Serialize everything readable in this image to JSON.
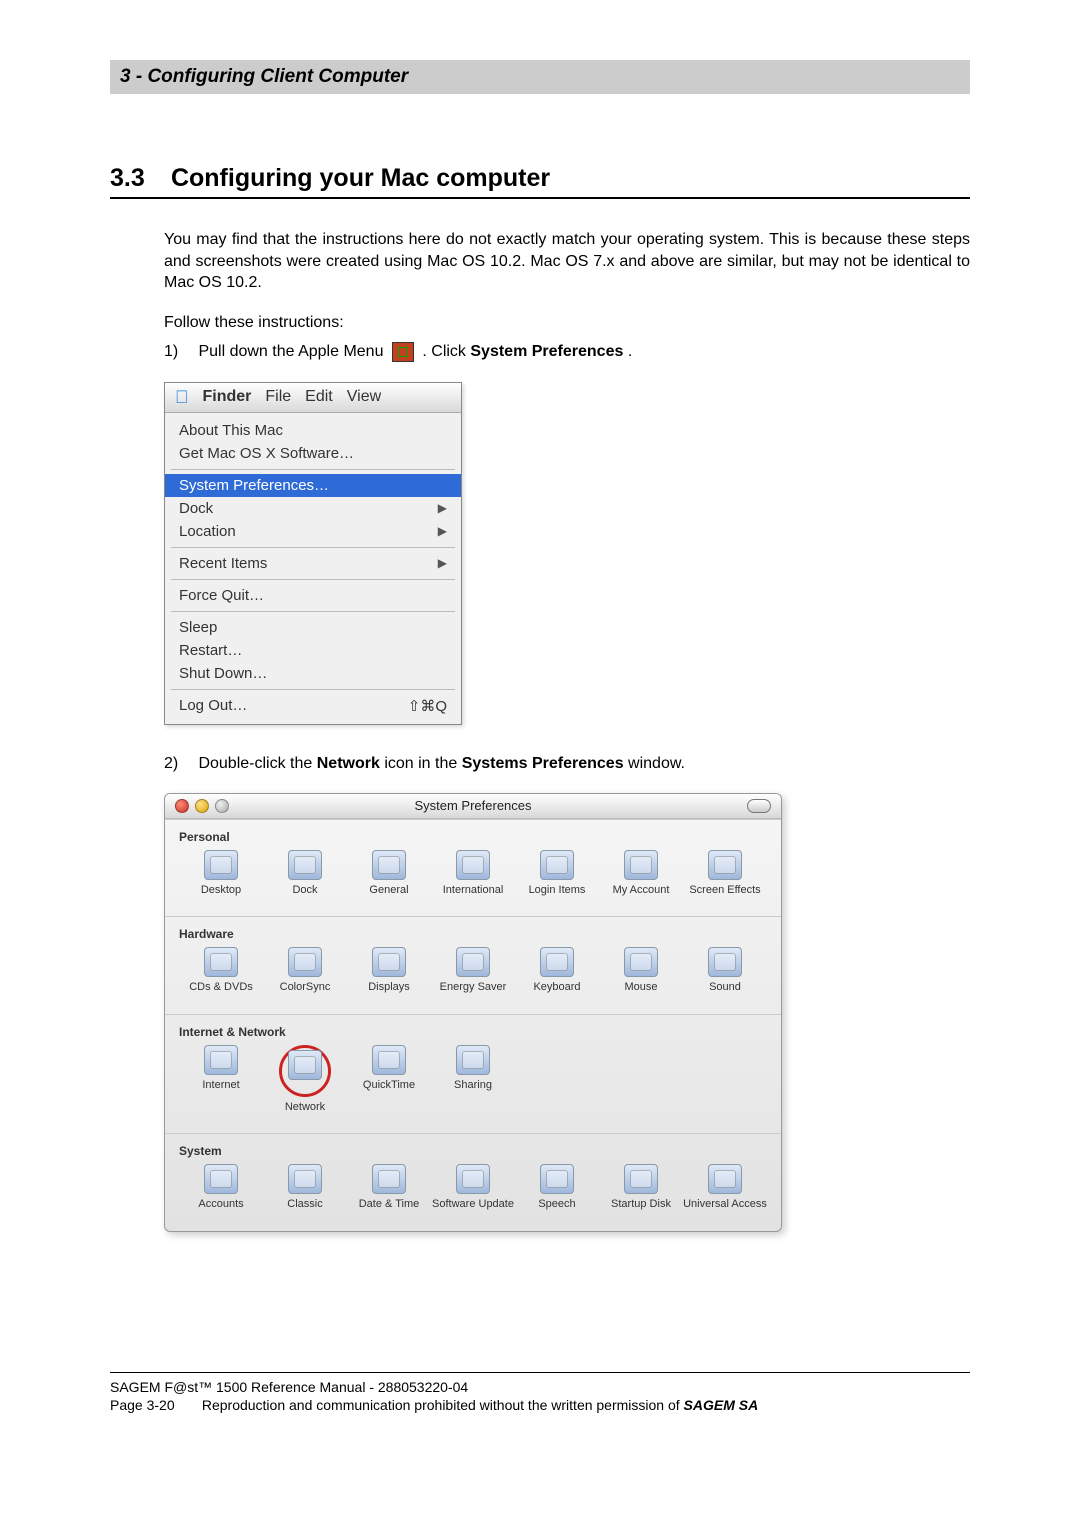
{
  "header": "3 - Configuring Client Computer",
  "section": {
    "number": "3.3",
    "title": "Configuring your Mac computer"
  },
  "body_paragraph": "You may find that the instructions here do not exactly match your operating system. This is because these steps and screenshots were created using Mac OS 10.2. Mac OS 7.x and above are similar, but may not be identical to Mac OS 10.2.",
  "follow": "Follow these instructions:",
  "step1": {
    "num": "1)",
    "pre": "Pull down the Apple Menu ",
    "post": ". Click ",
    "bold": "System Preferences",
    "end": "."
  },
  "step2": {
    "num": "2)",
    "pre": "Double-click the ",
    "b1": "Network",
    "mid": " icon in the ",
    "b2": "Systems Preferences",
    "post": " window."
  },
  "apple_menu": {
    "menubar": [
      "Finder",
      "File",
      "Edit",
      "View"
    ],
    "items": [
      {
        "label": "About This Mac"
      },
      {
        "label": "Get Mac OS X Software…"
      },
      {
        "sep": true
      },
      {
        "label": "System Preferences…",
        "selected": true
      },
      {
        "label": "Dock",
        "submenu": true
      },
      {
        "label": "Location",
        "submenu": true
      },
      {
        "sep": true
      },
      {
        "label": "Recent Items",
        "submenu": true
      },
      {
        "sep": true
      },
      {
        "label": "Force Quit…"
      },
      {
        "sep": true
      },
      {
        "label": "Sleep"
      },
      {
        "label": "Restart…"
      },
      {
        "label": "Shut Down…"
      },
      {
        "sep": true
      },
      {
        "label": "Log Out…",
        "shortcut": "⇧⌘Q"
      }
    ]
  },
  "sysprefs": {
    "title": "System Preferences",
    "sections": {
      "personal": {
        "title": "Personal",
        "items": [
          "Desktop",
          "Dock",
          "General",
          "International",
          "Login Items",
          "My Account",
          "Screen Effects"
        ]
      },
      "hardware": {
        "title": "Hardware",
        "items": [
          "CDs & DVDs",
          "ColorSync",
          "Displays",
          "Energy Saver",
          "Keyboard",
          "Mouse",
          "Sound"
        ]
      },
      "network": {
        "title": "Internet & Network",
        "items": [
          "Internet",
          "Network",
          "QuickTime",
          "Sharing"
        ]
      },
      "system": {
        "title": "System",
        "items": [
          "Accounts",
          "Classic",
          "Date & Time",
          "Software Update",
          "Speech",
          "Startup Disk",
          "Universal Access"
        ]
      }
    },
    "highlighted": "Network"
  },
  "footer": {
    "line1": "SAGEM F@st™ 1500 Reference Manual - 288053220-04",
    "page": "Page 3-20",
    "perm": "Reproduction and communication prohibited without the written permission of ",
    "brand": "SAGEM SA"
  }
}
